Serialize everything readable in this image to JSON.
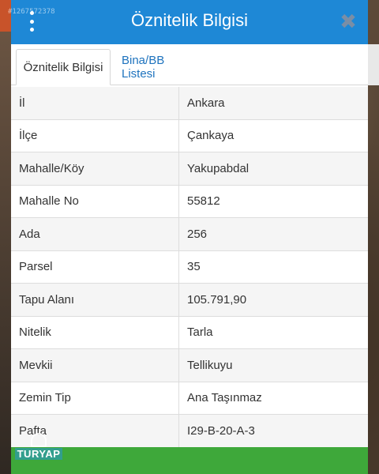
{
  "watermark": {
    "id_text": "#1267572378"
  },
  "header": {
    "title": "Öznitelik Bilgisi",
    "close_label": "✖"
  },
  "tabs": [
    {
      "label": "Öznitelik Bilgisi",
      "active": true
    },
    {
      "label": "Bina/BB Listesi",
      "active": false
    }
  ],
  "rows": [
    {
      "key": "İl",
      "value": "Ankara"
    },
    {
      "key": "İlçe",
      "value": "Çankaya"
    },
    {
      "key": "Mahalle/Köy",
      "value": "Yakupabdal"
    },
    {
      "key": "Mahalle No",
      "value": "55812"
    },
    {
      "key": "Ada",
      "value": "256"
    },
    {
      "key": "Parsel",
      "value": "35"
    },
    {
      "key": "Tapu Alanı",
      "value": "105.791,90"
    },
    {
      "key": "Nitelik",
      "value": "Tarla"
    },
    {
      "key": "Mevkii",
      "value": "Tellikuyu"
    },
    {
      "key": "Zemin Tip",
      "value": "Ana Taşınmaz"
    },
    {
      "key": "Pafta",
      "value": "I29-B-20-A-3"
    }
  ],
  "logo": {
    "text": "TURYAP"
  },
  "colors": {
    "header": "#1e88d6",
    "tab_link": "#1e73be",
    "footer": "#3ea83a"
  },
  "icons": {
    "menu": "kebab-icon",
    "close": "close-icon"
  }
}
